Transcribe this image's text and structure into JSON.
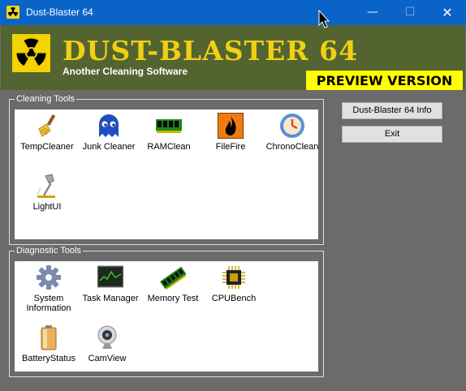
{
  "window": {
    "title": "Dust-Blaster 64"
  },
  "banner": {
    "title": "DUST-BLASTER 64",
    "subtitle": "Another Cleaning Software",
    "preview": "PREVIEW VERSION"
  },
  "cleaning": {
    "legend": "Cleaning Tools",
    "items": [
      {
        "label": "TempCleaner",
        "icon": "broom-icon"
      },
      {
        "label": "Junk Cleaner",
        "icon": "ghost-icon"
      },
      {
        "label": "RAMClean",
        "icon": "ram-icon"
      },
      {
        "label": "FileFire",
        "icon": "fire-icon"
      },
      {
        "label": "ChronoClean",
        "icon": "clock-icon"
      },
      {
        "label": "LightUI",
        "icon": "lamp-icon"
      }
    ]
  },
  "diagnostic": {
    "legend": "Diagnostic Tools",
    "items": [
      {
        "label1": "System",
        "label2": "Information",
        "icon": "gear-icon"
      },
      {
        "label": "Task Manager",
        "icon": "monitor-icon"
      },
      {
        "label": "Memory Test",
        "icon": "memory-stick-icon"
      },
      {
        "label": "CPUBench",
        "icon": "cpu-chip-icon"
      },
      {
        "label": "BatteryStatus",
        "icon": "battery-icon"
      },
      {
        "label": "CamView",
        "icon": "webcam-icon"
      }
    ]
  },
  "buttons": {
    "info": "Dust-Blaster 64 Info",
    "exit": "Exit"
  },
  "titlebar_buttons": {
    "minimize": "—",
    "maximize": "☐",
    "close": "✕"
  }
}
